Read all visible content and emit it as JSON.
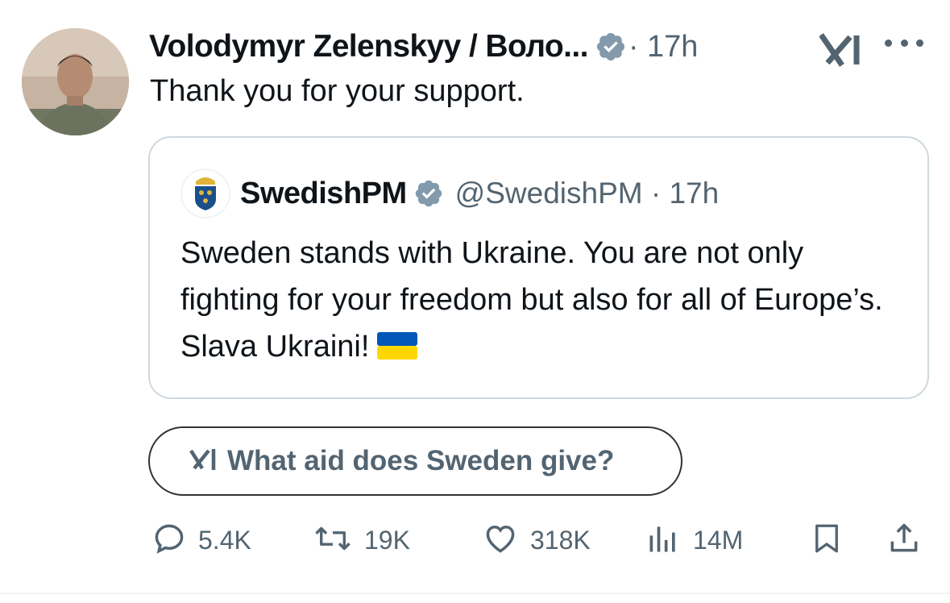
{
  "tweet": {
    "author_name": "Volodymyr Zelenskyy / Воло...",
    "time": "· 17h",
    "text": "Thank you for your support."
  },
  "quote": {
    "name": "SwedishPM",
    "handle_time": "@SwedishPM · 17h",
    "text": "Sweden stands with Ukraine. You are not only fighting for your freedom but also for all of Europe’s. Slava Ukraini!"
  },
  "grok_prompt": {
    "label": "What aid does Sweden give?"
  },
  "actions": {
    "replies": "5.4K",
    "reposts": "19K",
    "likes": "318K",
    "views": "14M"
  },
  "colors": {
    "text": "#0f1419",
    "secondary": "#536471",
    "verified_badge": "#829aab",
    "border": "#cfd9de",
    "flag_blue": "#0057b7",
    "flag_yellow": "#ffd700"
  },
  "icons": [
    "verified-badge-icon",
    "grok-icon",
    "more-icon",
    "reply-icon",
    "repost-icon",
    "like-icon",
    "views-icon",
    "bookmark-icon",
    "share-icon",
    "ukraine-flag-icon"
  ]
}
